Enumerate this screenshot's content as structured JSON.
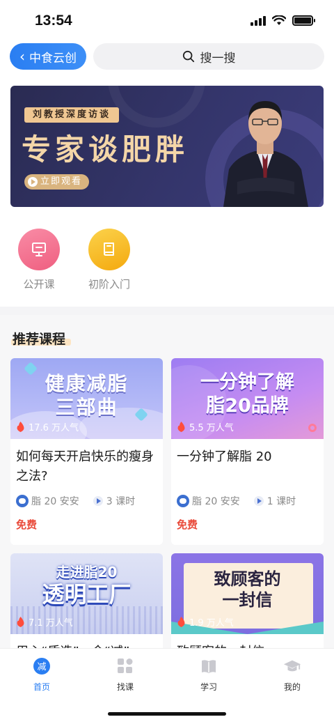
{
  "status": {
    "time": "13:54"
  },
  "header": {
    "back_label": "中食云创",
    "search_placeholder": "搜一搜"
  },
  "banner": {
    "tag": "刘教授深度访谈",
    "title": "专家谈肥胖",
    "watch_label": "立即观看"
  },
  "quick_links": [
    {
      "label": "公开课",
      "icon": "presentation-icon",
      "color": "#f26a8a"
    },
    {
      "label": "初阶入门",
      "icon": "book-icon",
      "color": "#f5b81c"
    }
  ],
  "recommend": {
    "title": "推荐课程",
    "courses": [
      {
        "thumb_text": "健康减脂三部曲",
        "thumb_line1": "健康减脂",
        "thumb_line2": "三部曲",
        "views": "17.6 万人气",
        "title": "如何每天开启快乐的瘦身之法?",
        "author": "脂 20 安安",
        "lessons": "3 课时",
        "price": "免费"
      },
      {
        "thumb_line1": "一分钟了解",
        "thumb_line2": "脂20品牌",
        "views": "5.5 万人气",
        "title": "一分钟了解脂 20",
        "author": "脂 20 安安",
        "lessons": "1 课时",
        "price": "免费"
      },
      {
        "thumb_line1": "走进脂20",
        "thumb_line2": "透明工厂",
        "views": "7.1 万人气",
        "title": "用心“质造”，令“减”"
      },
      {
        "thumb_line1": "致顾客的",
        "thumb_line2": "一封信",
        "views": "1.9 万人气",
        "title": "致顾客的一封信"
      }
    ]
  },
  "tabbar": {
    "items": [
      {
        "label": "首页",
        "icon": "home-icon",
        "active": true
      },
      {
        "label": "找课",
        "icon": "grid-icon",
        "active": false
      },
      {
        "label": "学习",
        "icon": "book-icon",
        "active": false
      },
      {
        "label": "我的",
        "icon": "graduation-cap-icon",
        "active": false
      }
    ]
  },
  "colors": {
    "accent": "#2a7ef2",
    "price": "#e94a3a",
    "banner_gold": "#f4d6a8"
  }
}
